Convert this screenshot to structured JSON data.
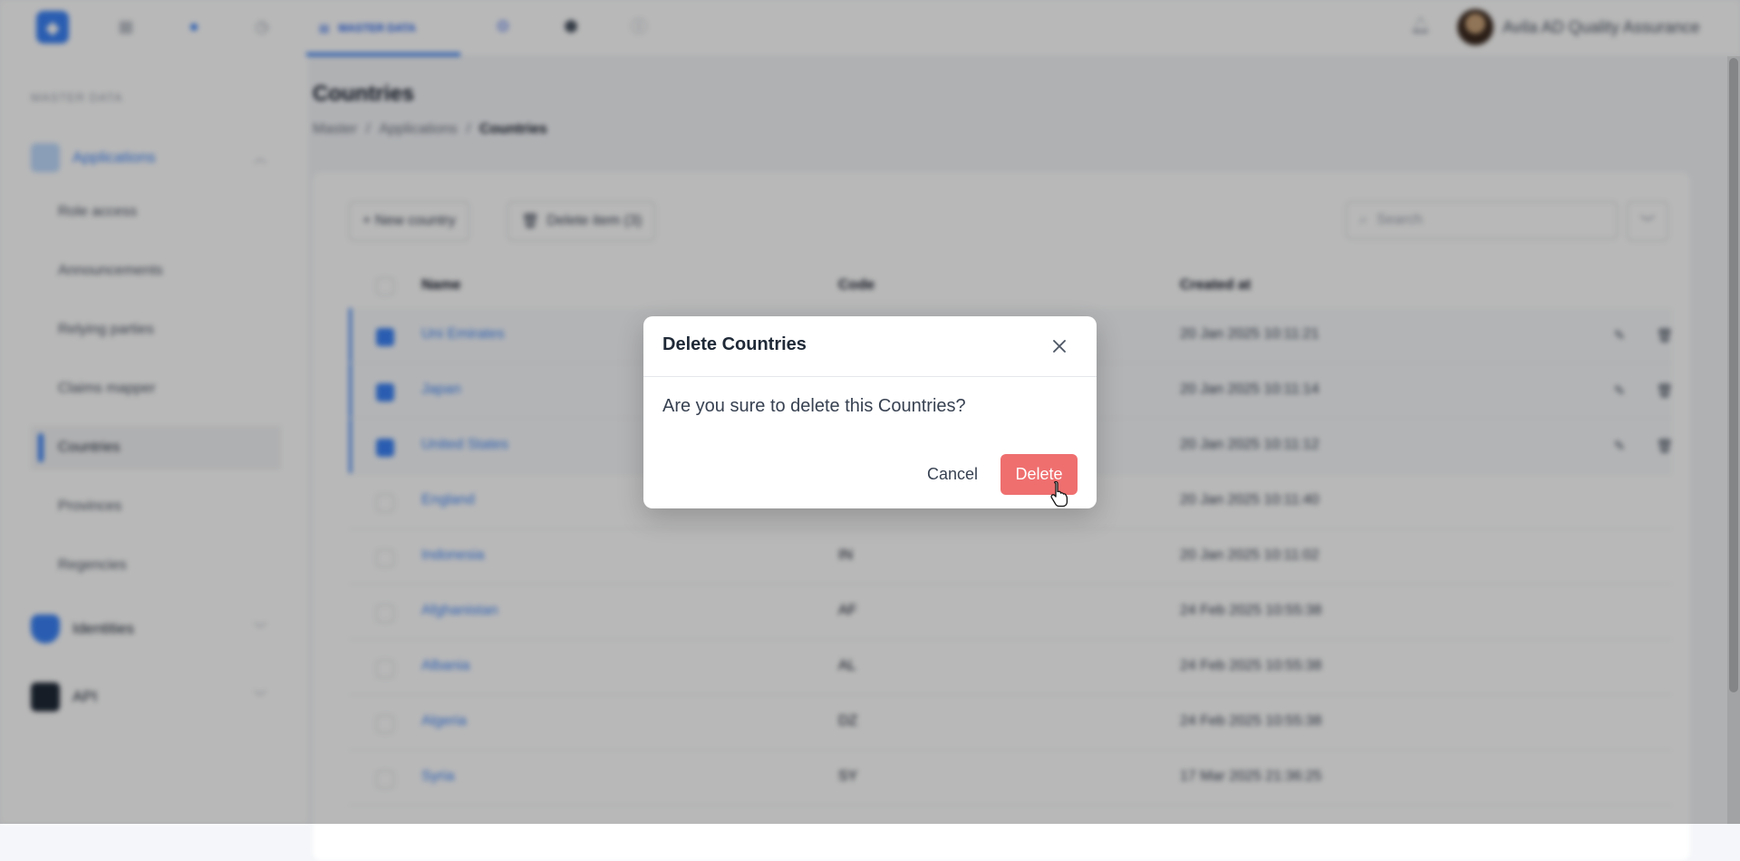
{
  "topbar": {
    "active_tab": "MASTER DATA",
    "username": "Avila AD Quality Assurance"
  },
  "sidebar": {
    "caption": "MASTER DATA",
    "groups": [
      {
        "label": "Applications",
        "color": "#3b82f6"
      },
      {
        "label": "Identities",
        "color": "#3b82f6"
      },
      {
        "label": "API",
        "color": "#111827"
      }
    ],
    "items": [
      {
        "label": "Role access"
      },
      {
        "label": "Announcements"
      },
      {
        "label": "Relying parties"
      },
      {
        "label": "Claims mapper"
      },
      {
        "label": "Countries"
      },
      {
        "label": "Provinces"
      },
      {
        "label": "Regencies"
      }
    ]
  },
  "page": {
    "title": "Countries",
    "breadcrumb": [
      "Master",
      "Applications",
      "Countries"
    ]
  },
  "toolbar": {
    "new_label": "+ New country",
    "delete_label": "Delete item (3)",
    "search_placeholder": "Search"
  },
  "table": {
    "headers": [
      "Name",
      "Code",
      "Created at"
    ],
    "rows": [
      {
        "name": "Uni Emirates",
        "code": "",
        "created": "20 Jan 2025 10:11:21",
        "selected": true
      },
      {
        "name": "Japan",
        "code": "",
        "created": "20 Jan 2025 10:11:14",
        "selected": true
      },
      {
        "name": "United States",
        "code": "",
        "created": "20 Jan 2025 10:11:12",
        "selected": true
      },
      {
        "name": "England",
        "code": "",
        "created": "20 Jan 2025 10:11:40",
        "selected": false
      },
      {
        "name": "Indonesia",
        "code": "IN",
        "created": "20 Jan 2025 10:11:02",
        "selected": false
      },
      {
        "name": "Afghanistan",
        "code": "AF",
        "created": "24 Feb 2025 10:55:38",
        "selected": false
      },
      {
        "name": "Albania",
        "code": "AL",
        "created": "24 Feb 2025 10:55:38",
        "selected": false
      },
      {
        "name": "Algeria",
        "code": "DZ",
        "created": "24 Feb 2025 10:55:38",
        "selected": false
      },
      {
        "name": "Syria",
        "code": "SY",
        "created": "17 Mar 2025 21:36:25",
        "selected": false
      }
    ]
  },
  "modal": {
    "title": "Delete Countries",
    "message": "Are you sure to delete this Countries?",
    "cancel_label": "Cancel",
    "delete_label": "Delete"
  },
  "colors": {
    "accent": "#3b82f6",
    "danger": "#ef6f6f"
  },
  "icons": [
    "app-logo-icon",
    "close-icon",
    "pointer-cursor-icon",
    "bell-icon",
    "search-icon",
    "trash-icon",
    "edit-icon"
  ]
}
